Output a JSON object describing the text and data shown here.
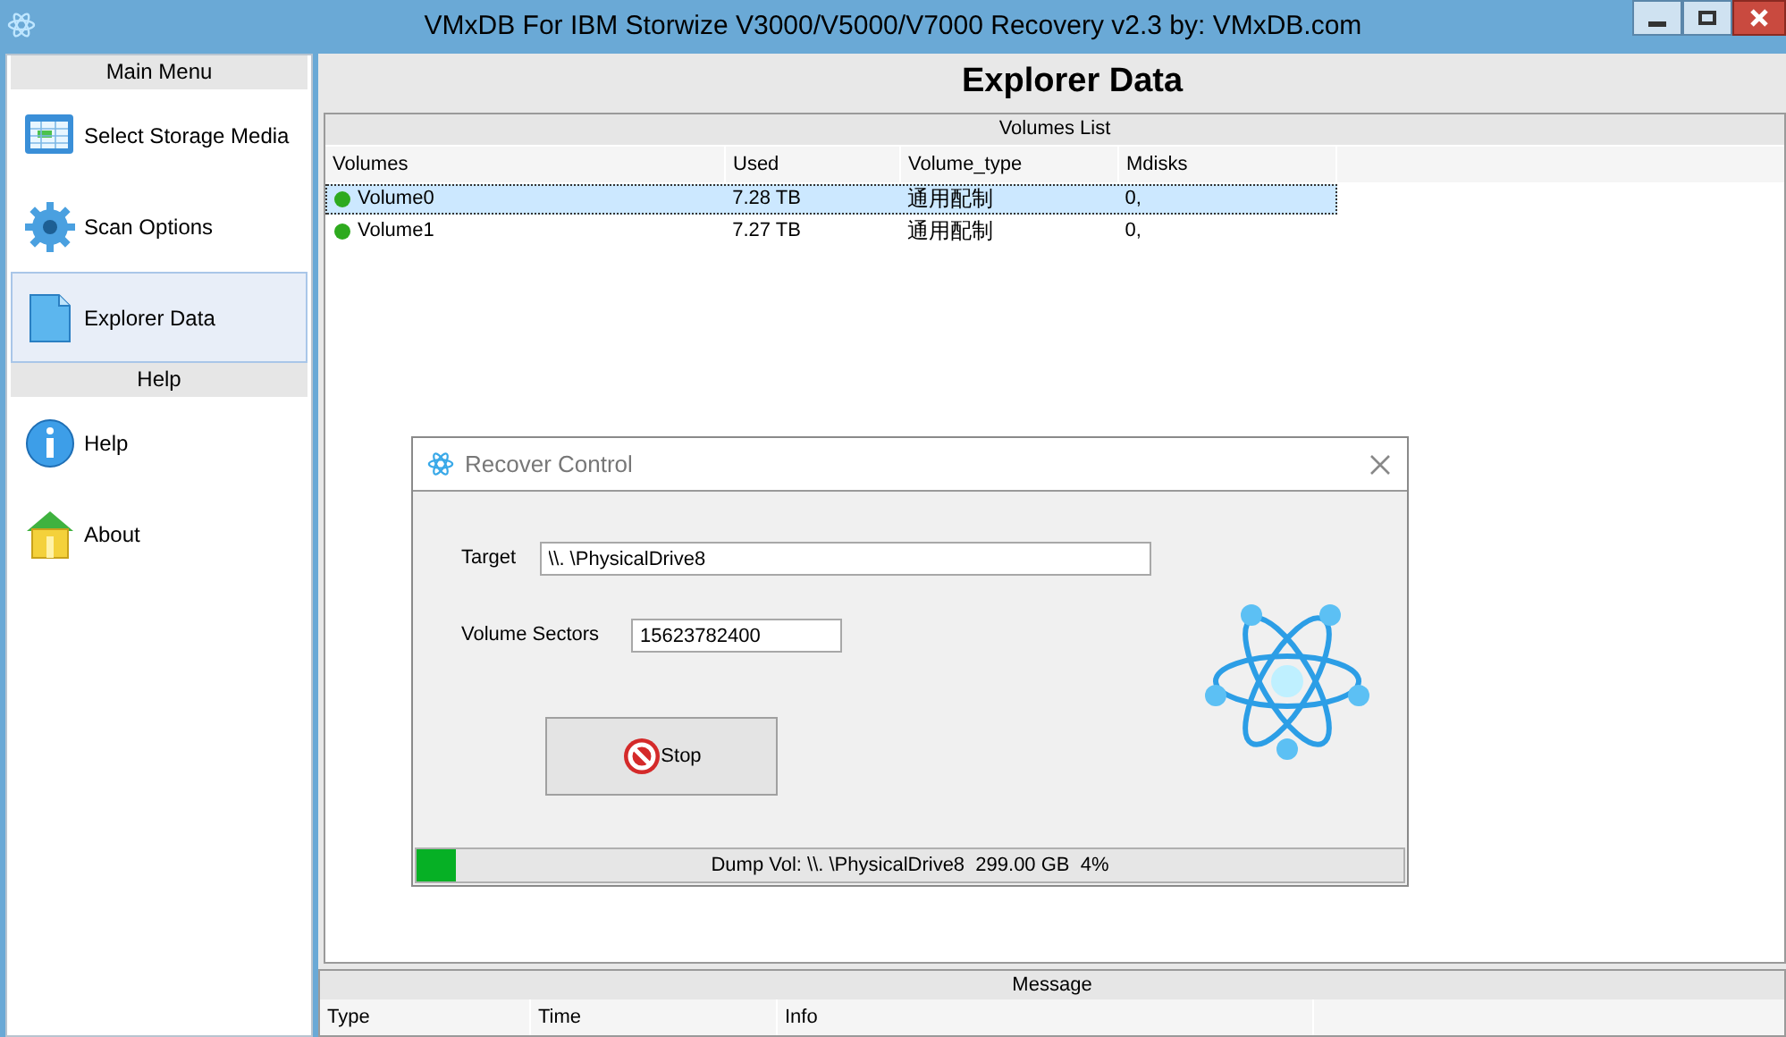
{
  "window": {
    "title": "VMxDB For IBM Storwize V3000/V5000/V7000 Recovery v2.3 by: VMxDB.com"
  },
  "sidebar": {
    "sections": [
      {
        "title": "Main Menu",
        "items": [
          {
            "label": "Select Storage Media",
            "kind": "media",
            "selected": false
          },
          {
            "label": "Scan Options",
            "kind": "gear",
            "selected": false
          },
          {
            "label": "Explorer Data",
            "kind": "document",
            "selected": true
          }
        ]
      },
      {
        "title": "Help",
        "items": [
          {
            "label": "Help",
            "kind": "info",
            "selected": false
          },
          {
            "label": "About",
            "kind": "house",
            "selected": false
          }
        ]
      }
    ]
  },
  "page_title": "Explorer Data",
  "volumes_list": {
    "title": "Volumes List",
    "columns": [
      "Volumes",
      "Used",
      "Volume_type",
      "Mdisks"
    ],
    "rows": [
      {
        "cells": [
          "Volume0",
          "7.28 TB",
          "通用配制",
          "0,"
        ],
        "selected": true
      },
      {
        "cells": [
          "Volume1",
          "7.27 TB",
          "通用配制",
          "0,"
        ],
        "selected": false
      }
    ]
  },
  "dialog": {
    "title": "Recover Control",
    "target_label": "Target",
    "target_value": "\\\\. \\PhysicalDrive8",
    "sectors_label": "Volume Sectors",
    "sectors_value": "15623782400",
    "stop_button": "Stop",
    "progress": {
      "level": 0.04,
      "text": "Dump Vol: \\\\. \\PhysicalDrive8  299.00 GB  4%"
    }
  },
  "message": {
    "title": "Message",
    "columns": [
      "Type",
      "Time",
      "Info"
    ]
  }
}
